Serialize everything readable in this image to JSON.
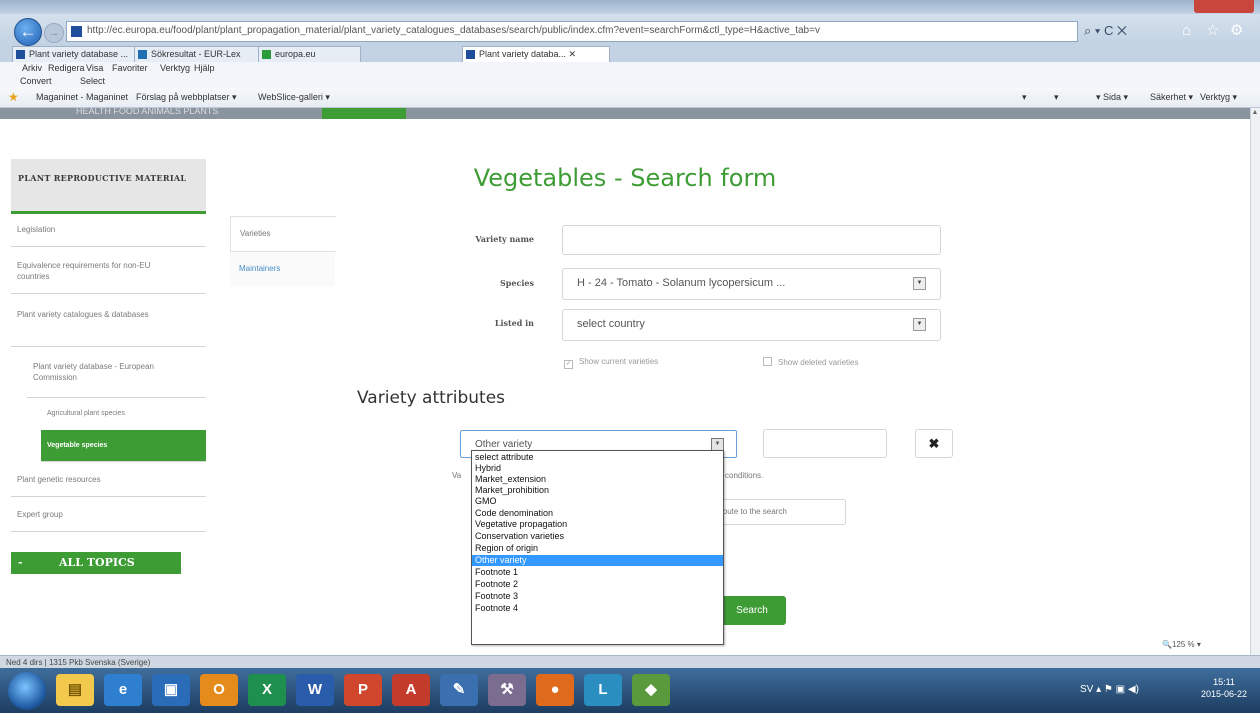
{
  "browser": {
    "url": "http://ec.europa.eu/food/plant/plant_propagation_material/plant_variety_catalogues_databases/search/public/index.cfm?event=searchForm&ctl_type=H&active_tab=v",
    "url_tools": "⌕ ▾ C ✕",
    "tabs": [
      {
        "label": "Plant variety database ..."
      },
      {
        "label": "Sökresultat - EUR-Lex"
      },
      {
        "label": "europa.eu"
      },
      {
        "label": "Plant variety databa... ✕"
      }
    ],
    "menu": [
      "Arkiv",
      "Redigera",
      "Visa",
      "Favoriter",
      "Verktyg",
      "Hjälp"
    ],
    "convert": {
      "label": "Convert",
      "select": "Select"
    },
    "favorites": [
      "Maganinet - Maganinet",
      "Förslag på webbplatser ▾",
      "WebSlice-galleri ▾"
    ],
    "commands": [
      "▾",
      "▾",
      "▾ Sida ▾",
      "Säkerhet ▾",
      "Verktyg ▾"
    ],
    "zoom": "🔍125 % ▾",
    "status": "Ned 4 dirs | 1315 Pkb    Svenska (Sverige)"
  },
  "site": {
    "nav_strip": "HEALTH    FOOD    ANIMALS    PLANTS"
  },
  "sidebar": {
    "header": "PLANT REPRODUCTIVE MATERIAL",
    "items": [
      {
        "label": "Legislation"
      },
      {
        "label": "Equivalence requirements for non-EU countries"
      },
      {
        "label": "Plant variety catalogues & databases"
      },
      {
        "label": "Plant variety database - European Commission"
      },
      {
        "label": "Agricultural plant species"
      },
      {
        "label": "Vegetable species"
      },
      {
        "label": "Plant genetic resources"
      },
      {
        "label": "Expert group"
      }
    ],
    "all_topics": {
      "dash": "-",
      "label": "ALL TOPICS"
    }
  },
  "form": {
    "title": "Vegetables - Search form",
    "tabs": [
      {
        "label": "Varieties"
      },
      {
        "label": "Maintainers"
      }
    ],
    "variety_name_label": "Variety name",
    "variety_name_value": "",
    "species_label": "Species",
    "species_value": "H - 24 - Tomato - Solanum lycopersicum ...",
    "listed_in_label": "Listed in",
    "listed_in_value": "select country",
    "show_current": "Show current varieties",
    "show_deleted": "Show deleted varieties",
    "show_current_checked": true,
    "show_deleted_checked": false,
    "attributes_heading": "Variety attributes",
    "attribute_selected": "Other variety",
    "attribute_value": "",
    "remove_glyph": "✖",
    "help_left": "Va",
    "help_right": "conditions.",
    "add_button": "ibute to the search",
    "search_button": "Search"
  },
  "dropdown": {
    "options": [
      "select attribute",
      "Hybrid",
      "Market_extension",
      "Market_prohibition",
      "GMO",
      "Code denomination",
      "Vegetative propagation",
      "Conservation varieties",
      "Region of origin",
      "Other variety",
      "Footnote 1",
      "Footnote 2",
      "Footnote 3",
      "Footnote 4"
    ],
    "selected_index": 9
  },
  "taskbar": {
    "tray": "SV  ▴  ⚑  ▣  ◀)",
    "time": "15:11",
    "date": "2015-06-22"
  }
}
